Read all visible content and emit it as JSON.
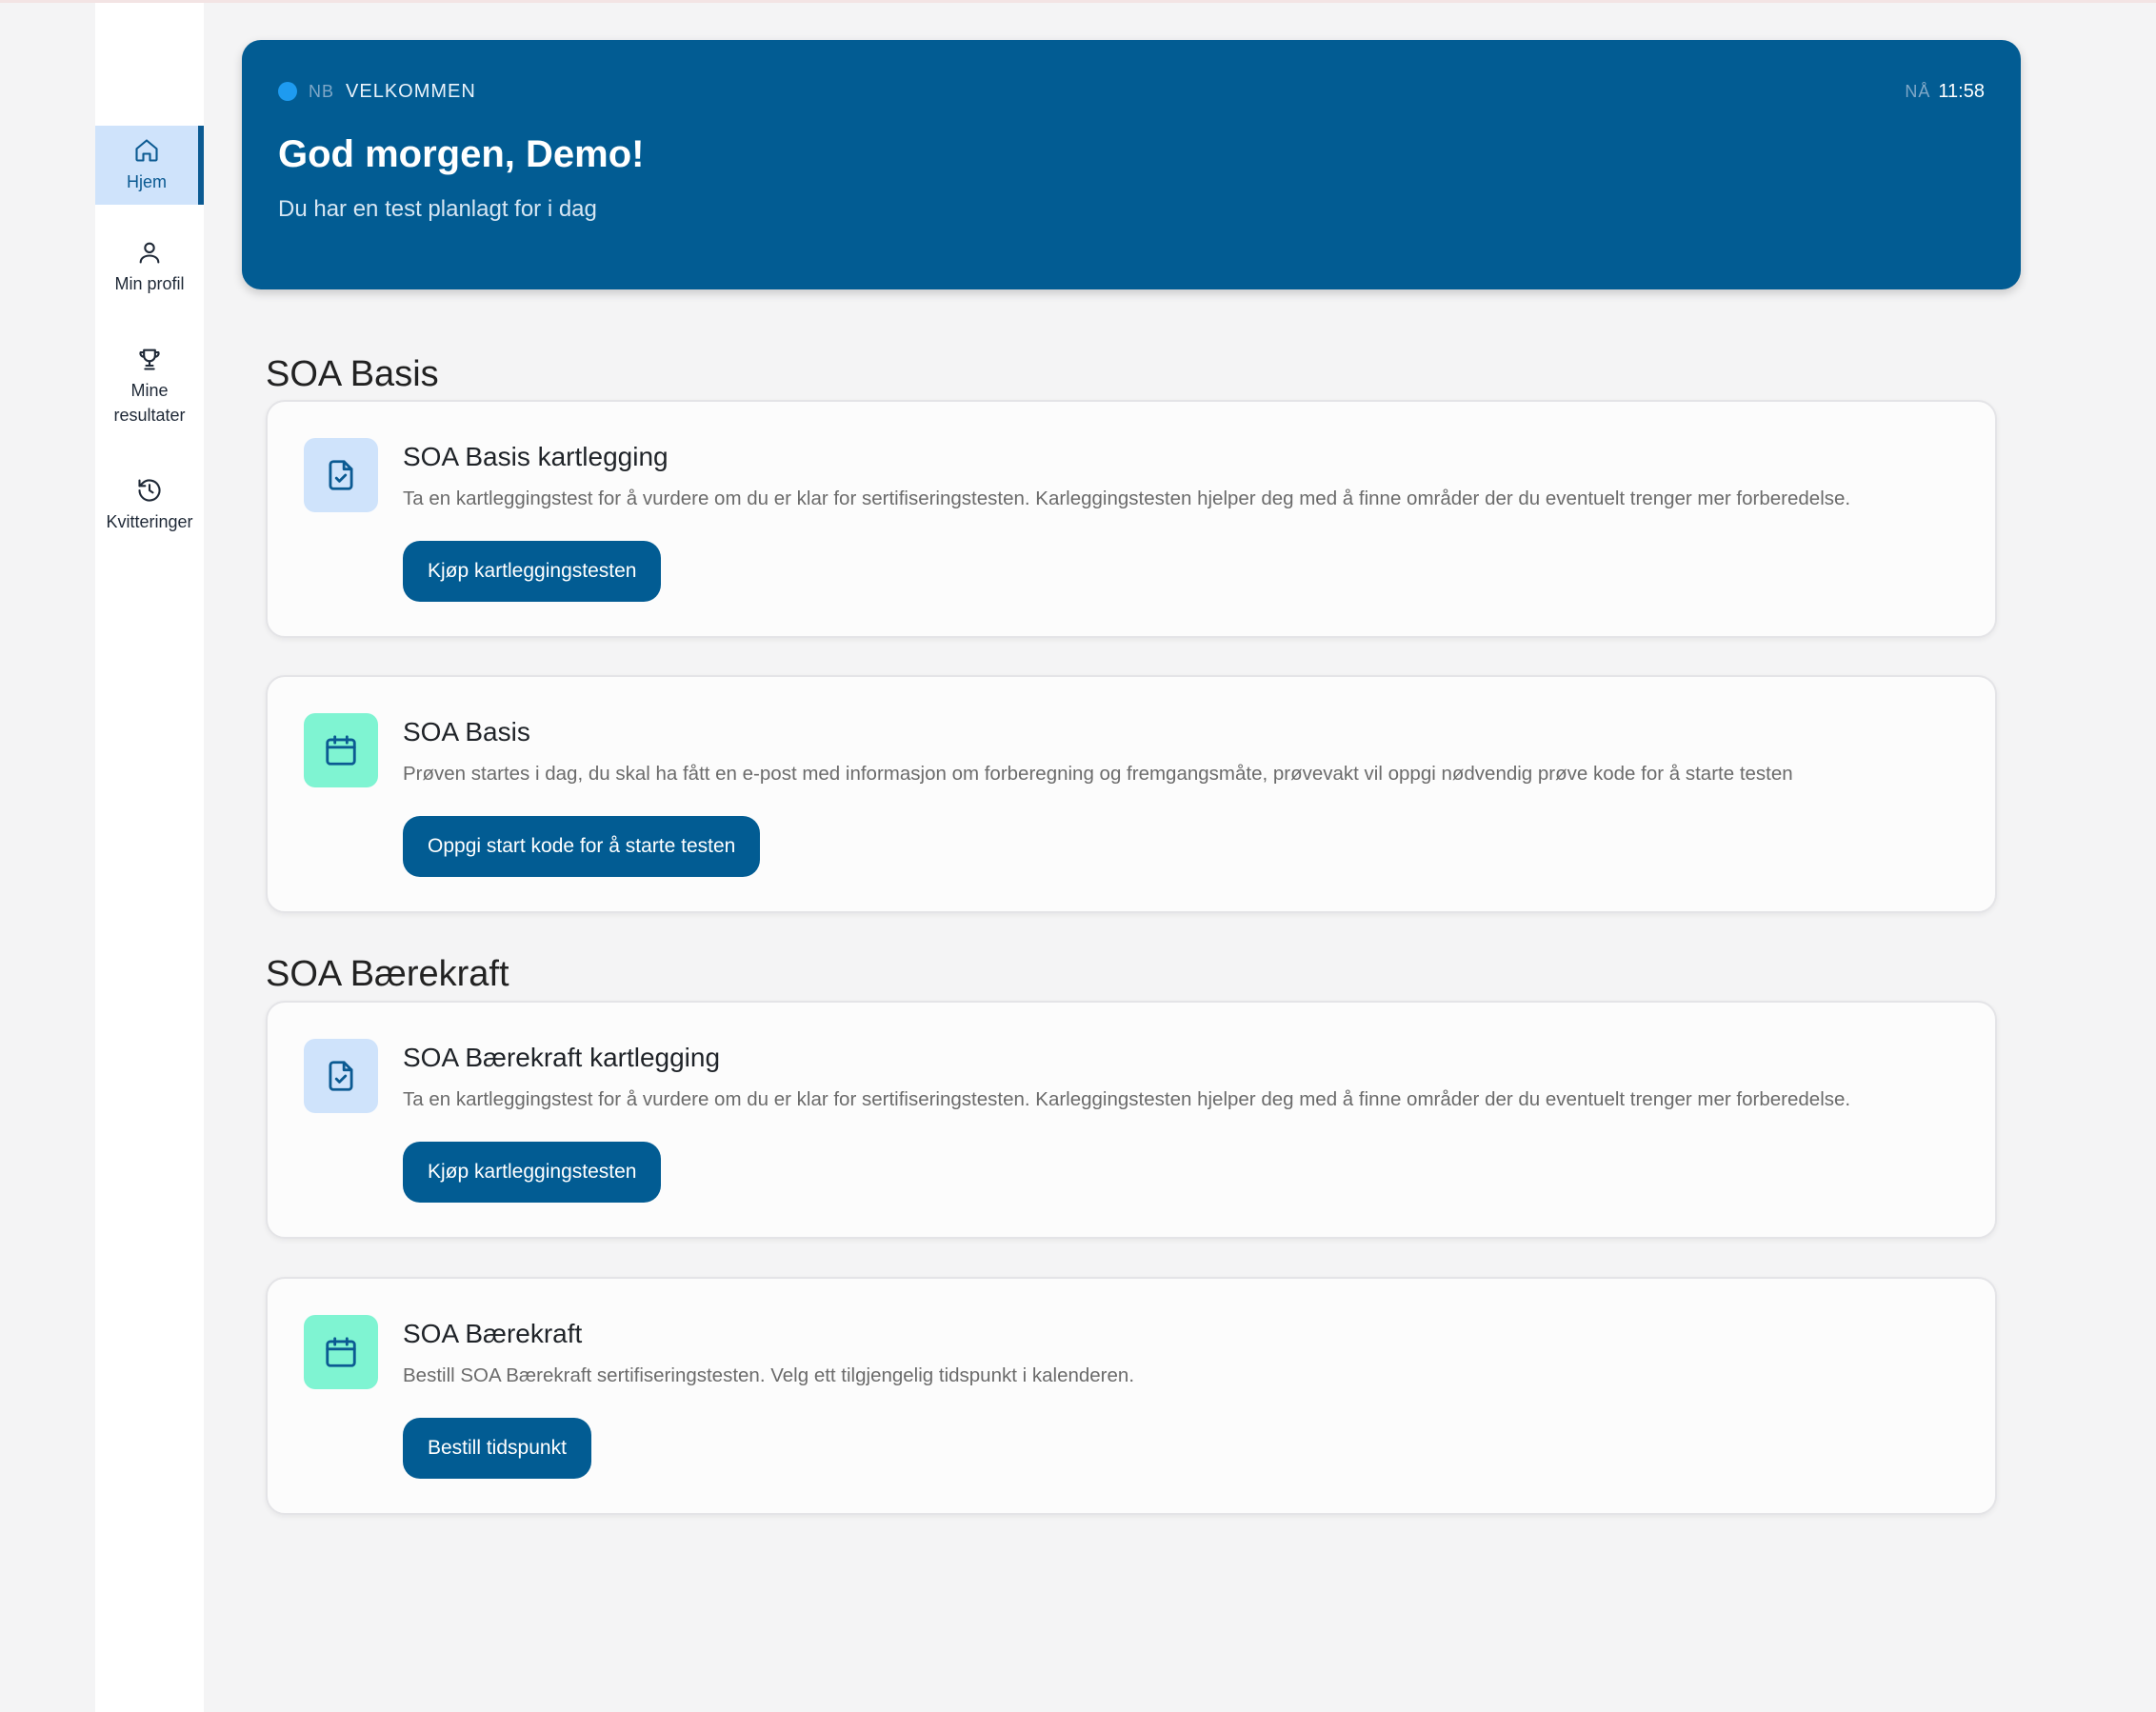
{
  "sidebar": {
    "items": [
      {
        "label": "Hjem",
        "icon": "home-icon",
        "active": true
      },
      {
        "label": "Min profil",
        "icon": "user-icon",
        "active": false
      },
      {
        "label": "Mine\nresultater",
        "icon": "trophy-icon",
        "active": false
      },
      {
        "label": "Kvitteringer",
        "icon": "history-icon",
        "active": false
      }
    ]
  },
  "banner": {
    "tag": "NB",
    "label": "VELKOMMEN",
    "time_prefix": "NÅ",
    "time": "11:58",
    "title": "God morgen, Demo!",
    "subtitle": "Du har en test planlagt for i dag"
  },
  "sections": [
    {
      "title": "SOA Basis",
      "cards": [
        {
          "icon": "document-check-icon",
          "title": "SOA Basis kartlegging",
          "description": "Ta en kartleggingstest for å vurdere om du er klar for sertifiseringstesten. Karleggingstesten hjelper deg med å finne områder der du eventuelt trenger mer forberedelse.",
          "button": "Kjøp kartleggingstesten"
        },
        {
          "icon": "calendar-icon",
          "title": "SOA Basis",
          "description": "Prøven startes i dag, du skal ha fått en e-post med informasjon om forberegning og fremgangsmåte, prøvevakt vil oppgi nødvendig prøve kode for å starte testen",
          "button": "Oppgi start kode for å starte testen"
        }
      ]
    },
    {
      "title": "SOA Bærekraft",
      "cards": [
        {
          "icon": "document-check-icon",
          "title": "SOA Bærekraft kartlegging",
          "description": "Ta en kartleggingstest for å vurdere om du er klar for sertifiseringstesten. Karleggingstesten hjelper deg med å finne områder der du eventuelt trenger mer forberedelse.",
          "button": "Kjøp kartleggingstesten"
        },
        {
          "icon": "calendar-icon",
          "title": "SOA Bærekraft",
          "description": "Bestill SOA Bærekraft sertifiseringstesten. Velg ett tilgjengelig tidspunkt i kalenderen.",
          "button": "Bestill tidspunkt"
        }
      ]
    }
  ],
  "colors": {
    "primary": "#025c93",
    "accent_blue_light": "#cfe3fb",
    "accent_green": "#7ff4d2",
    "status_dot": "#1e9bf0"
  }
}
